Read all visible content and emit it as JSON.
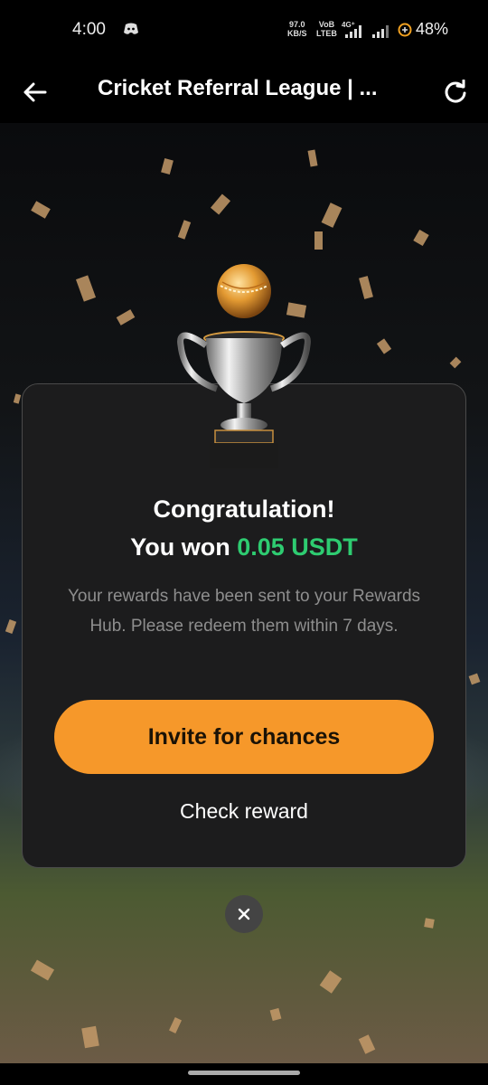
{
  "status_bar": {
    "time": "4:00",
    "net_speed_value": "97.0",
    "net_speed_unit": "KB/S",
    "volte_top": "VoB",
    "volte_bottom": "LTEB",
    "battery": "48%"
  },
  "app_bar": {
    "title": "Cricket Referral League | ..."
  },
  "dialog": {
    "heading": "Congratulation!",
    "won_prefix": "You won ",
    "won_amount": "0.05 USDT",
    "description": "Your rewards have been sent to your Rewards Hub. Please redeem them within 7 days.",
    "primary_button": "Invite for chances",
    "secondary_button": "Check reward"
  },
  "colors": {
    "accent_orange": "#f6982a",
    "amount_green": "#2ecc71",
    "card_bg": "#1c1c1d"
  },
  "icons": {
    "back": "arrow-left-icon",
    "refresh": "refresh-icon",
    "close": "close-icon",
    "trophy": "trophy-icon"
  }
}
